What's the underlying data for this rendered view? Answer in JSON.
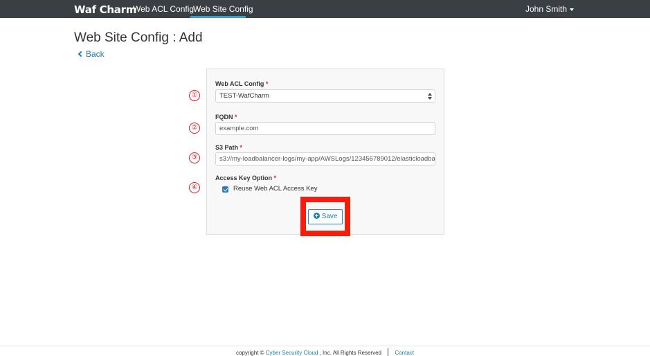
{
  "navbar": {
    "logo": "Waf Charm",
    "links": [
      "Web ACL Config",
      "Web Site Config"
    ],
    "active_link": "Web Site Config",
    "user": "John Smith"
  },
  "page": {
    "title": "Web Site Config : Add",
    "back_label": "Back"
  },
  "form": {
    "markers": [
      "①",
      "②",
      "③",
      "④"
    ],
    "web_acl_label": "Web ACL Config",
    "web_acl_value": "TEST-WafCharm",
    "fqdn_label": "FQDN",
    "fqdn_placeholder": "example.com",
    "s3_label": "S3 Path",
    "s3_value": "s3://my-loadbalancer-logs/my-app/AWSLogs/123456789012/elasticloadbala",
    "access_key_label": "Access Key Option",
    "access_key_checkbox_label": "Reuse Web ACL Access Key",
    "access_key_checked": true,
    "required_mark": "*",
    "save_label": "Save"
  },
  "footer": {
    "copyright_prefix": "copyright ©",
    "company": "Cyber Security Cloud",
    "copyright_suffix": ", Inc. All Rights Reserved",
    "contact": "Contact"
  },
  "colors": {
    "navbar_bg": "#3a3f44",
    "accent": "#1c7db5",
    "highlight_red": "#ff1a0a",
    "required_red": "#d9262b"
  }
}
